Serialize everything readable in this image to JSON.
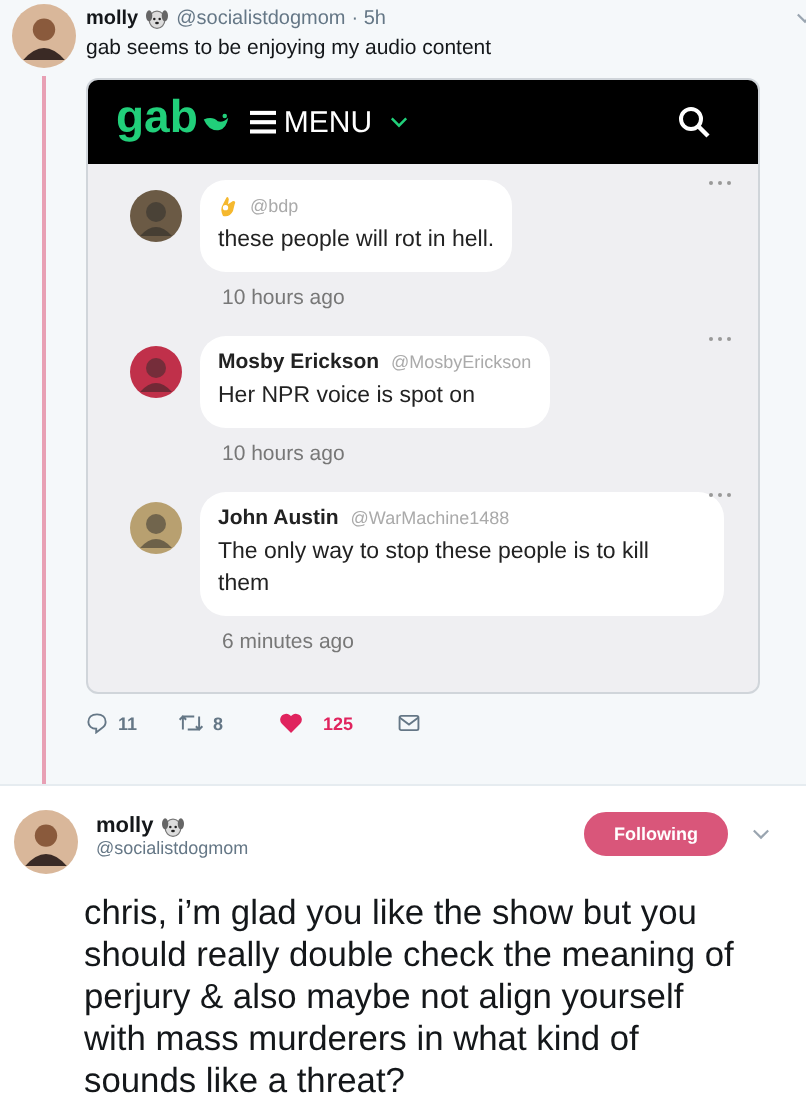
{
  "thread_tweet": {
    "name": "molly",
    "handle": "@socialistdogmom",
    "time": "· 5h",
    "text": "gab seems to be enjoying my audio content",
    "screenshot": {
      "logo": "gab",
      "menu_label": "MENU",
      "posts": [
        {
          "kind": "emoji",
          "handle": "@bdp",
          "text": "these people will rot in hell.",
          "time": "10 hours ago"
        },
        {
          "kind": "named",
          "name": "Mosby Erickson",
          "handle": "@MosbyErickson",
          "text": "Her NPR voice is spot on",
          "time": "10 hours ago"
        },
        {
          "kind": "named",
          "name": "John Austin",
          "handle": "@WarMachine1488",
          "text": "The only way to stop these people is to kill them",
          "time": "6 minutes ago"
        }
      ]
    },
    "actions": {
      "replies": "11",
      "retweets": "8",
      "likes": "125",
      "liked": true
    }
  },
  "reply_tweet": {
    "name": "molly",
    "handle": "@socialistdogmom",
    "follow_button": "Following",
    "following": true,
    "text": "chris, i’m glad you like the show but you should really double check the meaning of perjury & also maybe not align yourself with mass murderers in what kind of sounds like a threat?"
  }
}
